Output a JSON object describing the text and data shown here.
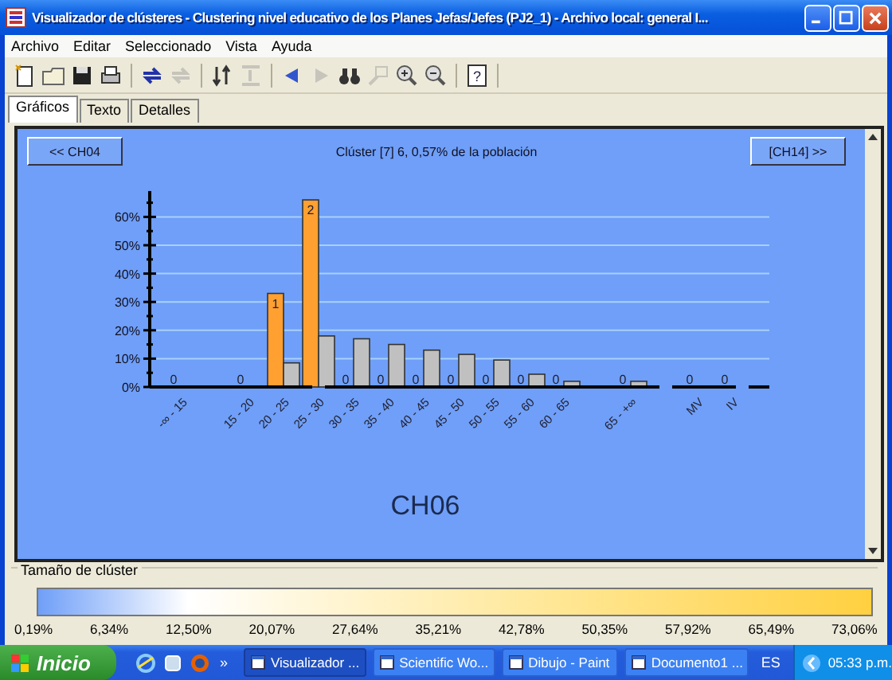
{
  "window": {
    "title": "Visualizador de clústeres - Clustering nivel educativo de los Planes Jefas/Jefes (PJ2_1) - Archivo local: general I..."
  },
  "menu": [
    "Archivo",
    "Editar",
    "Seleccionado",
    "Vista",
    "Ayuda"
  ],
  "toolbar": [
    [
      {
        "disabled": false
      },
      {
        "disabled": false
      },
      {
        "disabled": false
      },
      {
        "disabled": false
      }
    ],
    [
      {
        "disabled": false
      },
      {
        "disabled": true
      }
    ],
    [
      {
        "disabled": false
      },
      {
        "disabled": true
      }
    ],
    [
      {
        "disabled": false
      },
      {
        "disabled": true
      },
      {
        "disabled": false
      },
      {
        "disabled": true
      },
      {
        "disabled": false
      },
      {
        "disabled": false
      }
    ],
    [
      {
        "disabled": false,
        "label": "?"
      }
    ]
  ],
  "tabs": [
    {
      "label": "Gráficos",
      "selected": true
    },
    {
      "label": "Texto",
      "selected": false
    },
    {
      "label": "Detalles",
      "selected": false
    }
  ],
  "chart_panel": {
    "prev_button": "<< CH04",
    "next_button": "[CH14] >>",
    "title": "Clúster [7] 6, 0,57% de la población",
    "variable": "CH06",
    "chart_data": {
      "type": "bar",
      "categories": [
        "-∞ - 15",
        "15 - 20",
        "20 - 25",
        "25 - 30",
        "30 - 35",
        "35 - 40",
        "40 - 45",
        "45 - 50",
        "50 - 55",
        "55 - 60",
        "60 - 65",
        "65 - +∞",
        "MV",
        "IV"
      ],
      "series": [
        {
          "color": "#ffa030",
          "values": [
            0,
            0,
            33,
            66,
            0,
            0,
            0,
            0,
            0,
            0,
            0,
            0,
            0,
            0
          ]
        },
        {
          "color": "#c0c0c0",
          "values": [
            0,
            null,
            8.5,
            18,
            17,
            15,
            13,
            11.5,
            9.5,
            4.5,
            2,
            2,
            0,
            0
          ]
        }
      ],
      "ylim": [
        0,
        68
      ],
      "grid": true,
      "yticks": [
        {
          "value": 0,
          "label": "0%"
        },
        {
          "value": 10,
          "label": "10%"
        },
        {
          "value": 20,
          "label": "20%"
        },
        {
          "value": 30,
          "label": "30%"
        },
        {
          "value": 40,
          "label": "40%"
        },
        {
          "value": 50,
          "label": "50%"
        },
        {
          "value": 60,
          "label": "60%"
        }
      ],
      "value_labels": [
        "0",
        "0",
        "1",
        "2",
        "0",
        "0",
        "0",
        "0",
        "0",
        "0",
        "0",
        "0",
        "0",
        "0"
      ]
    }
  },
  "legend": {
    "title": "Tamaño de clúster",
    "ticks": [
      "0,19%",
      "6,34%",
      "12,50%",
      "20,07%",
      "27,64%",
      "35,21%",
      "42,78%",
      "50,35%",
      "57,92%",
      "65,49%",
      "73,06%"
    ]
  },
  "taskbar": {
    "start": "Inicio",
    "more": "»",
    "tasks": [
      {
        "label": "Visualizador ...",
        "selected": true
      },
      {
        "label": "Scientific Wo...",
        "selected": false
      },
      {
        "label": "Dibujo - Paint",
        "selected": false
      },
      {
        "label": "Documento1 ...",
        "selected": false
      }
    ],
    "language": "ES",
    "clock": "05:33 p.m."
  }
}
